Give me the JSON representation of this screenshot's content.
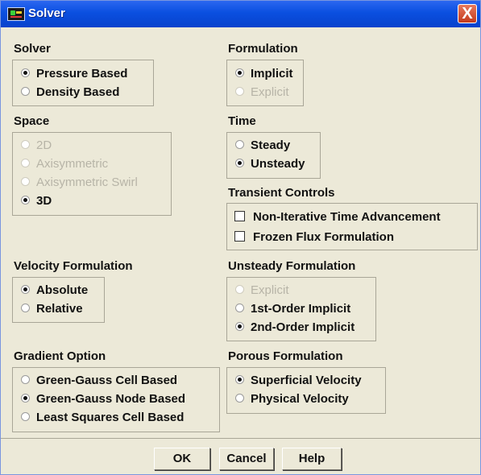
{
  "window": {
    "title": "Solver",
    "close_label": "X"
  },
  "solver": {
    "label": "Solver",
    "options": [
      "Pressure Based",
      "Density Based"
    ],
    "selected": "Pressure Based"
  },
  "formulation": {
    "label": "Formulation",
    "options": [
      "Implicit",
      "Explicit"
    ],
    "selected": "Implicit",
    "disabled": [
      "Explicit"
    ]
  },
  "space": {
    "label": "Space",
    "options": [
      "2D",
      "Axisymmetric",
      "Axisymmetric Swirl",
      "3D"
    ],
    "selected": "3D",
    "disabled": [
      "2D",
      "Axisymmetric",
      "Axisymmetric Swirl"
    ]
  },
  "time": {
    "label": "Time",
    "options": [
      "Steady",
      "Unsteady"
    ],
    "selected": "Unsteady"
  },
  "transient_controls": {
    "label": "Transient Controls",
    "options": [
      "Non-Iterative Time Advancement",
      "Frozen Flux Formulation"
    ],
    "checked": []
  },
  "velocity_formulation": {
    "label": "Velocity Formulation",
    "options": [
      "Absolute",
      "Relative"
    ],
    "selected": "Absolute"
  },
  "unsteady_formulation": {
    "label": "Unsteady Formulation",
    "options": [
      "Explicit",
      "1st-Order Implicit",
      "2nd-Order Implicit"
    ],
    "selected": "2nd-Order Implicit",
    "disabled": [
      "Explicit"
    ]
  },
  "gradient_option": {
    "label": "Gradient Option",
    "options": [
      "Green-Gauss Cell Based",
      "Green-Gauss Node Based",
      "Least Squares Cell Based"
    ],
    "selected": "Green-Gauss Node Based"
  },
  "porous_formulation": {
    "label": "Porous Formulation",
    "options": [
      "Superficial Velocity",
      "Physical Velocity"
    ],
    "selected": "Superficial Velocity"
  },
  "buttons": {
    "ok": "OK",
    "cancel": "Cancel",
    "help": "Help"
  }
}
